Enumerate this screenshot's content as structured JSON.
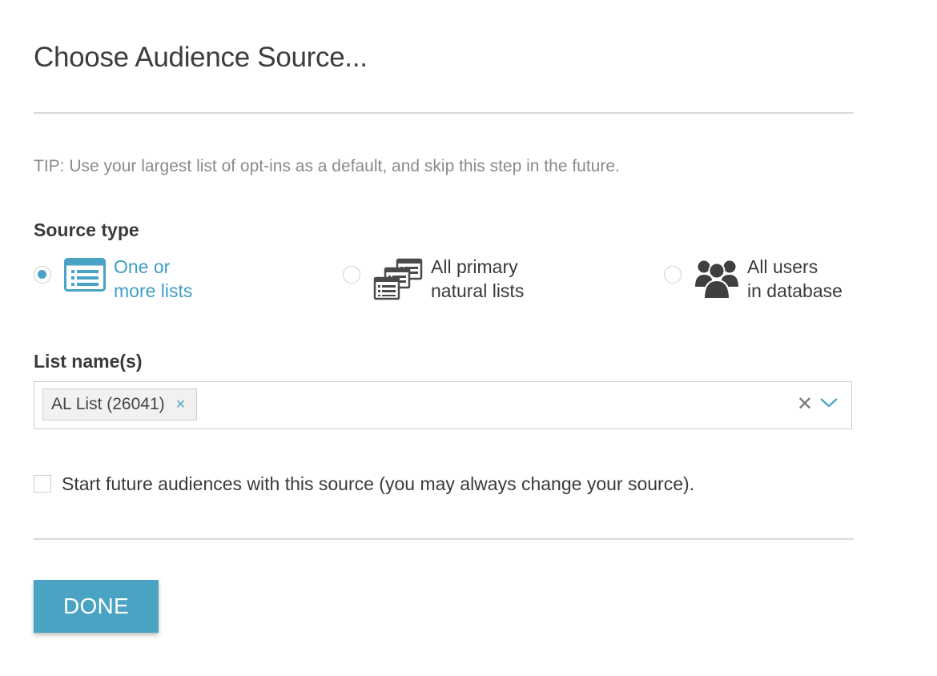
{
  "dialog": {
    "title": "Choose Audience Source...",
    "tip": "TIP: Use your largest list of opt-ins as a default, and skip this step in the future."
  },
  "source_type": {
    "label": "Source type",
    "selected": "one_or_more_lists",
    "options": [
      {
        "line1": "One or",
        "line2": "more lists",
        "icon": "list-icon",
        "checked": true
      },
      {
        "line1": "All primary",
        "line2": "natural lists",
        "icon": "stacked-lists-icon",
        "checked": false
      },
      {
        "line1": "All users",
        "line2": "in database",
        "icon": "users-group-icon",
        "checked": false
      }
    ]
  },
  "list_names": {
    "label": "List name(s)",
    "selected_tags": [
      {
        "text": "AL List (26041)",
        "remove_glyph": "×"
      }
    ],
    "clear_glyph": "✕"
  },
  "default_source": {
    "label": "Start future audiences with this source (you may always change your source).",
    "checked": false
  },
  "actions": {
    "done_label": "DONE"
  },
  "colors": {
    "accent": "#4ba3c3",
    "selected_text": "#3e9ec4",
    "icon_dark": "#3f3f3f",
    "divider": "#d9d9d9"
  }
}
